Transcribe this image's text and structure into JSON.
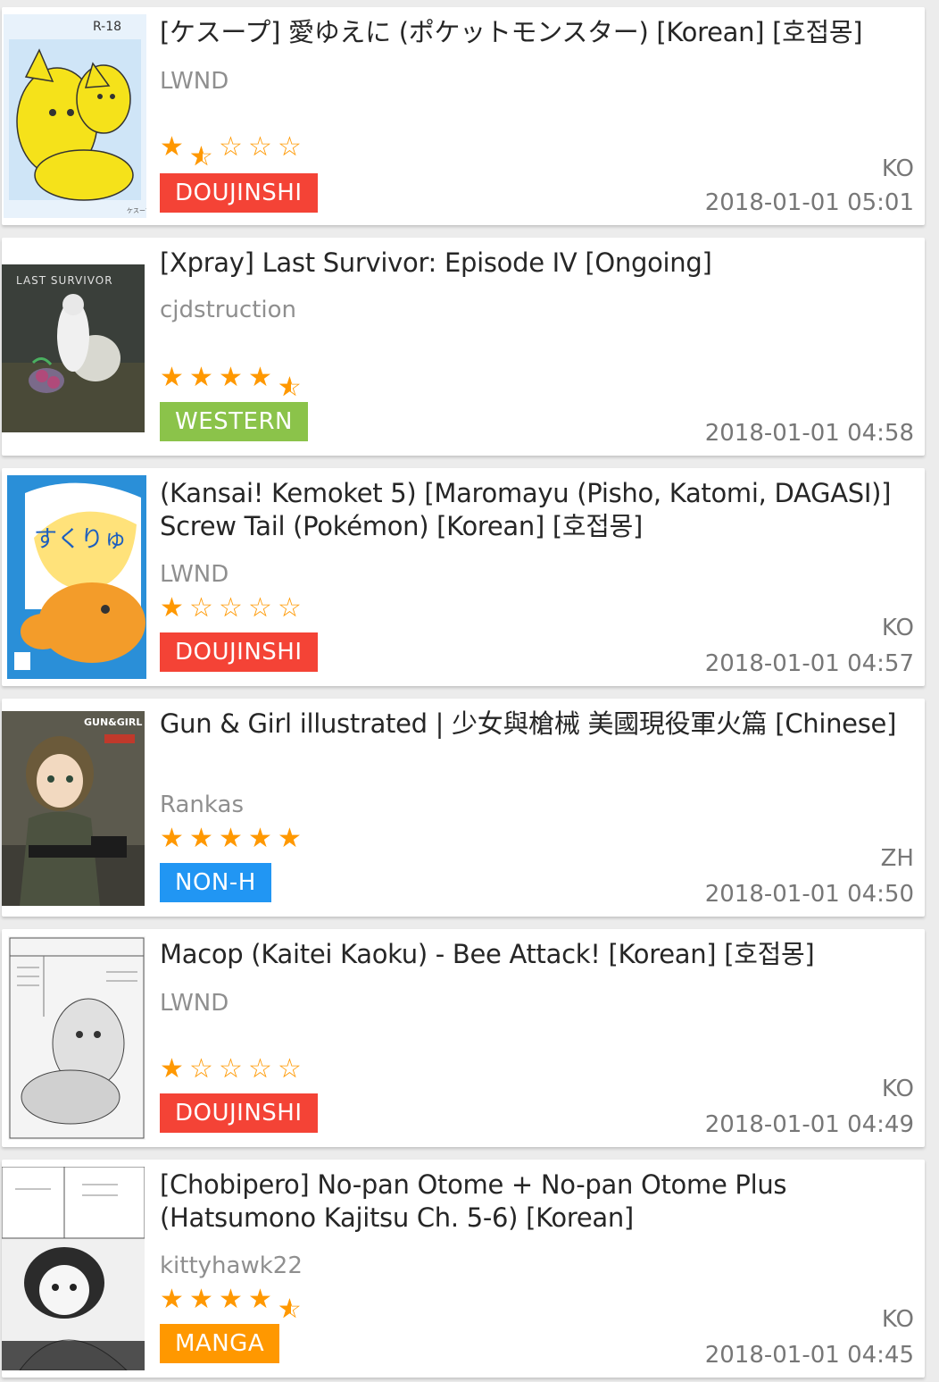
{
  "colors": {
    "star": "#ff9800",
    "doujinshi": "#f44336",
    "western": "#8bc34a",
    "non_h": "#2196f3",
    "manga": "#ff9800"
  },
  "items": [
    {
      "title": "[ケスープ] 愛ゆえに (ポケットモンスター) [Korean] [호접몽]",
      "uploader": "LWND",
      "rating": 1.5,
      "category": "DOUJINSHI",
      "language": "KO",
      "date": "2018-01-01 05:01",
      "thumb_icon": "cover-yellow-pokemon",
      "thumb_text": "R-18"
    },
    {
      "title": "[Xpray] Last Survivor: Episode IV [Ongoing]",
      "uploader": "cjdstruction",
      "rating": 4.5,
      "category": "WESTERN",
      "language": "",
      "date": "2018-01-01 04:58",
      "thumb_icon": "cover-dark-western",
      "thumb_text": "LAST SURVIVOR"
    },
    {
      "title": "(Kansai! Kemoket 5) [Maromayu (Pisho, Katomi, DAGASI)] Screw Tail (Pokémon) [Korean] [호접몽]",
      "uploader": "LWND",
      "rating": 1,
      "category": "DOUJINSHI",
      "language": "KO",
      "date": "2018-01-01 04:57",
      "thumb_icon": "cover-blue-orange",
      "thumb_text": "すくりゅ"
    },
    {
      "title": "Gun & Girl illustrated | 少女與槍械 美國現役軍火篇 [Chinese]",
      "uploader": "Rankas",
      "rating": 5,
      "category": "NON-H",
      "language": "ZH",
      "date": "2018-01-01 04:50",
      "thumb_icon": "cover-gun-girl",
      "thumb_text": "GUN&GIRL"
    },
    {
      "title": "Macop (Kaitei Kaoku) - Bee Attack! [Korean] [호접몽]",
      "uploader": "LWND",
      "rating": 1,
      "category": "DOUJINSHI",
      "language": "KO",
      "date": "2018-01-01 04:49",
      "thumb_icon": "cover-bw-manga-page",
      "thumb_text": ""
    },
    {
      "title": "[Chobipero] No-pan Otome + No-pan Otome Plus (Hatsumono Kajitsu Ch. 5-6) [Korean]",
      "uploader": "kittyhawk22",
      "rating": 4.5,
      "category": "MANGA",
      "language": "KO",
      "date": "2018-01-01 04:45",
      "thumb_icon": "cover-bw-manga",
      "thumb_text": ""
    }
  ]
}
